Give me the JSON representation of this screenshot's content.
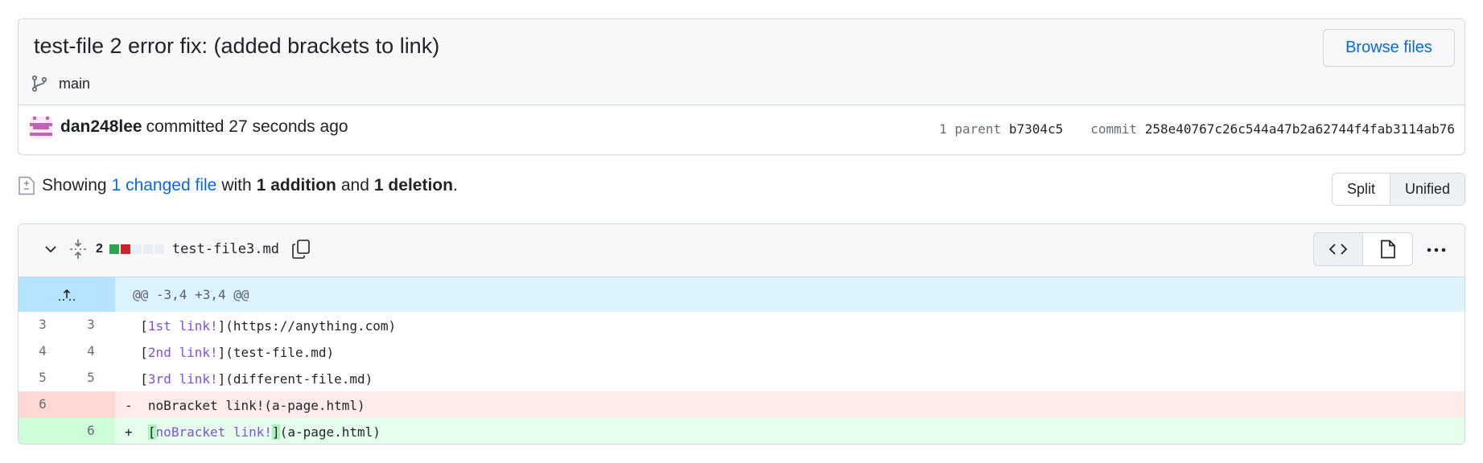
{
  "commit": {
    "title": "test-file 2 error fix: (added brackets to link)",
    "branch": "main",
    "browse_label": "Browse files",
    "author": "dan248lee",
    "action": "committed 27 seconds ago",
    "parent_label": "1 parent",
    "parent_sha": "b7304c5",
    "commit_label": "commit",
    "commit_sha": "258e40767c26c544a47b2a62744f4fab3114ab76"
  },
  "summary": {
    "showing": "Showing",
    "changed_files": "1 changed file",
    "with": "with",
    "additions": "1 addition",
    "and": "and",
    "deletions": "1 deletion",
    "period": "."
  },
  "view_toggle": {
    "split": "Split",
    "unified": "Unified",
    "selected": "Unified"
  },
  "file": {
    "change_count": "2",
    "name": "test-file3.md",
    "hunk_header": "@@ -3,4 +3,4 @@",
    "lines": [
      {
        "old": "3",
        "new": "3",
        "sign": " ",
        "pre": "[",
        "link": "1st link!",
        "post": "](https://anything.com)"
      },
      {
        "old": "4",
        "new": "4",
        "sign": " ",
        "pre": "[",
        "link": "2nd link!",
        "post": "](test-file.md)"
      },
      {
        "old": "5",
        "new": "5",
        "sign": " ",
        "pre": "[",
        "link": "3rd link!",
        "post": "](different-file.md)"
      },
      {
        "old": "6",
        "new": "",
        "sign": "-",
        "text": "noBracket link!(a-page.html)"
      },
      {
        "old": "",
        "new": "6",
        "sign": "+",
        "pre": "[",
        "link": "noBracket link!",
        "post": "](a-page.html)"
      }
    ]
  },
  "icons": {
    "branch": "git-branch-icon",
    "file_diff": "file-diff-icon",
    "chevron": "chevron-down-icon",
    "expand": "unfold-icon",
    "copy": "copy-icon",
    "code": "code-icon",
    "file": "file-icon",
    "kebab": "kebab-horizontal-icon",
    "expand_up": "fold-up-icon"
  },
  "colors": {
    "accent": "#0969da",
    "added": "#1a7f37",
    "deleted": "#cf222e",
    "hunk_bg": "#ddf4ff"
  }
}
